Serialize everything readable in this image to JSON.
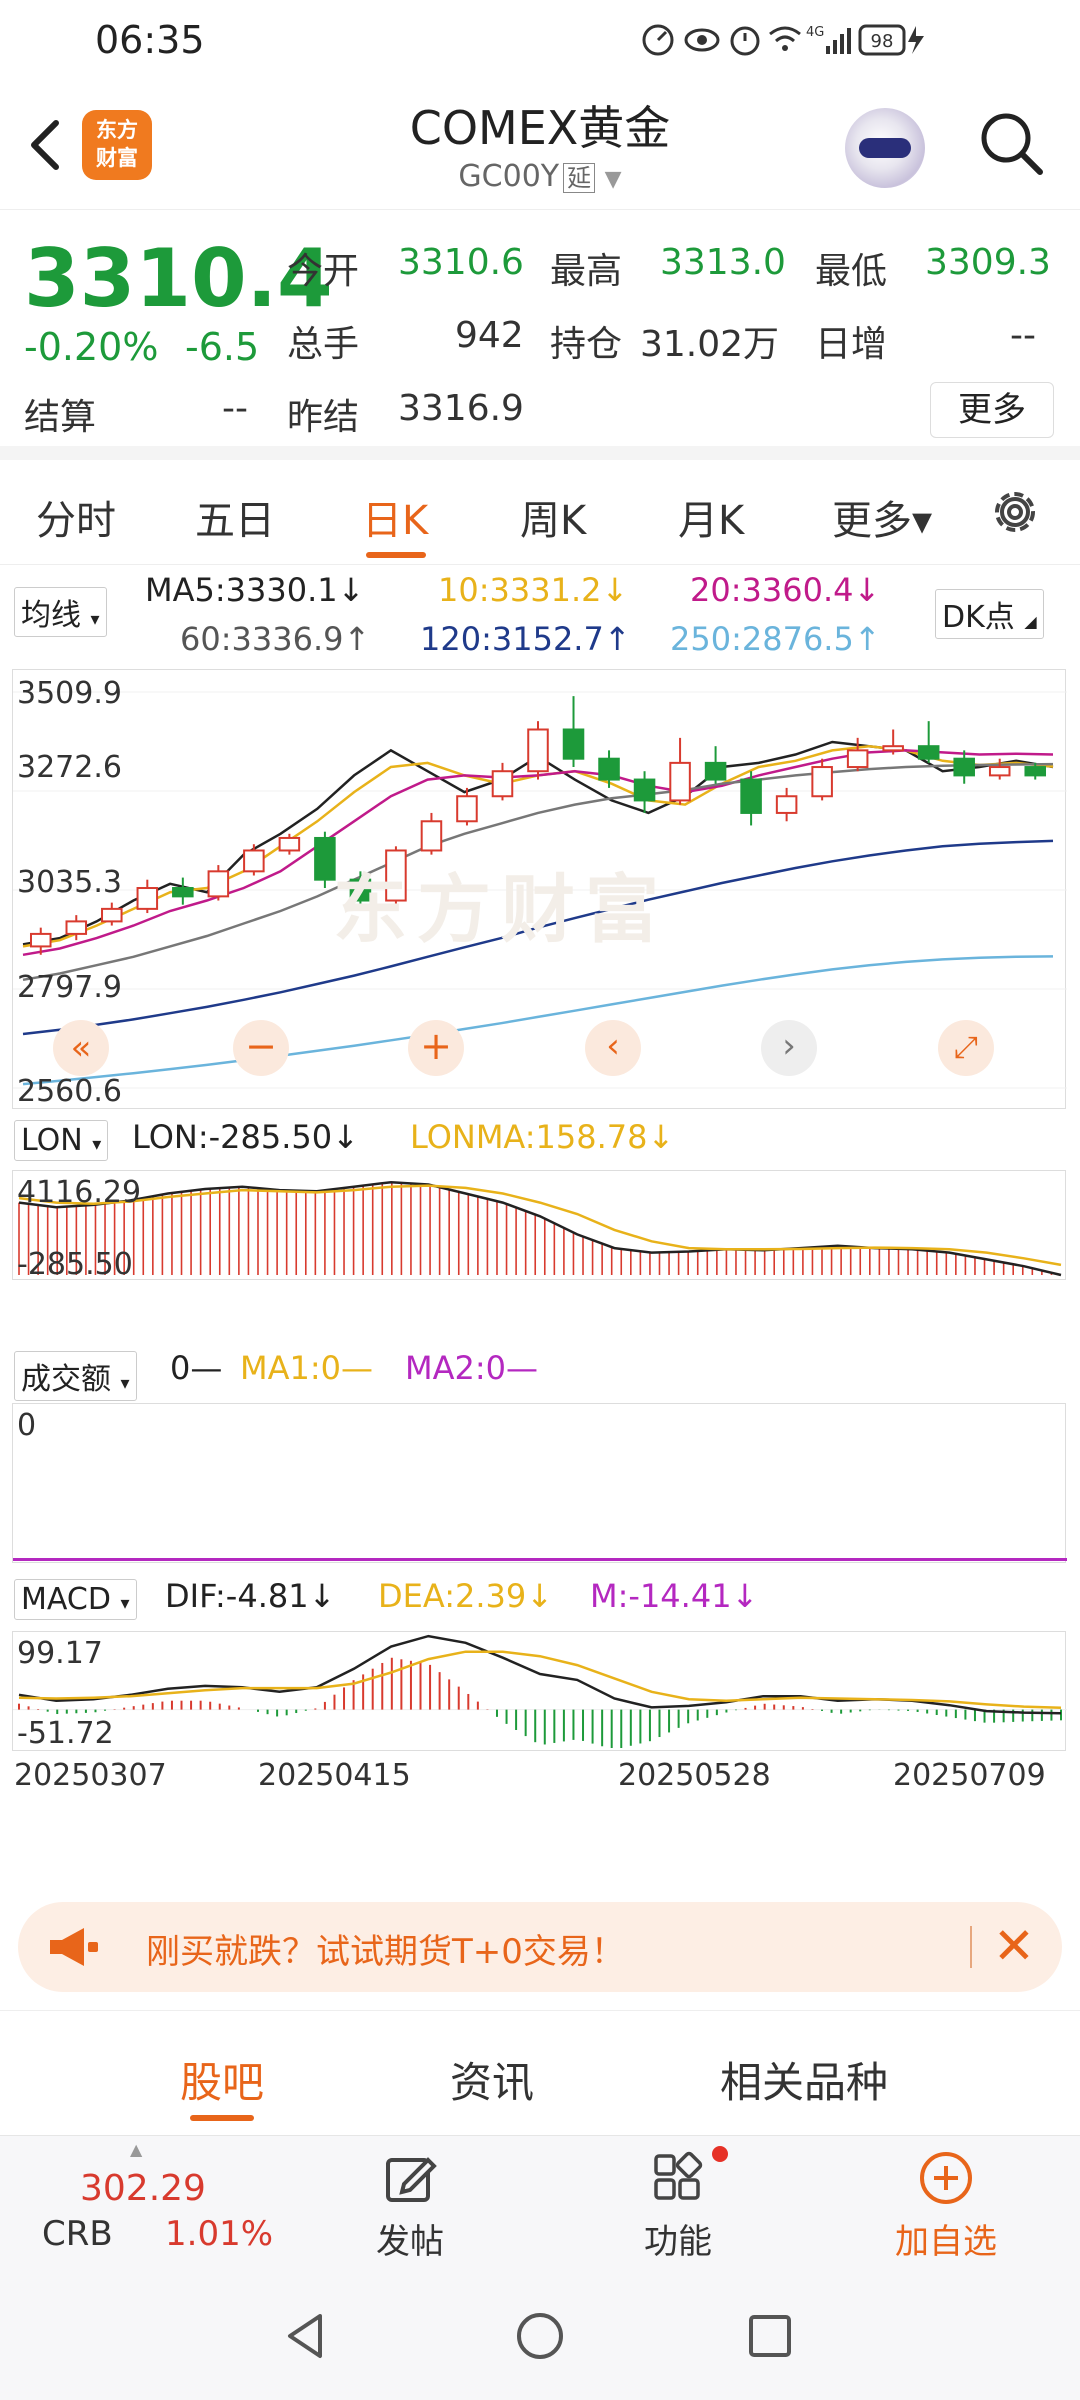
{
  "status_bar": {
    "time": "06:35",
    "network": "4G",
    "battery": "98"
  },
  "header": {
    "logo_line1": "东方",
    "logo_line2": "财富",
    "title": "COMEX黄金",
    "code": "GC00Y",
    "delay_tag": "延"
  },
  "quote": {
    "price": "3310.4",
    "change_pct": "-0.20%",
    "change_abs": "-6.5",
    "settle_label": "结算",
    "settle_value": "--",
    "open_label": "今开",
    "open_value": "3310.6",
    "high_label": "最高",
    "high_value": "3313.0",
    "low_label": "最低",
    "low_value": "3309.3",
    "volume_label": "总手",
    "volume_value": "942",
    "oi_label": "持仓",
    "oi_value": "31.02万",
    "daily_inc_label": "日增",
    "daily_inc_value": "--",
    "prev_settle_label": "昨结",
    "prev_settle_value": "3316.9",
    "more_label": "更多"
  },
  "period_tabs": [
    "分时",
    "五日",
    "日K",
    "周K",
    "月K",
    "更多▾"
  ],
  "active_period": "日K",
  "colors": {
    "accent": "#e8651a",
    "up": "#d83a2e",
    "down": "#1d9a3a",
    "ma5": "#222222",
    "ma10": "#e8b21a",
    "ma20": "#c01a8a",
    "ma60": "#777777",
    "ma120": "#1f3a8a",
    "ma250": "#6ab4dc"
  },
  "ma_legend": {
    "selector": "均线",
    "ma5": "MA5:3330.1↓",
    "ma10": "10:3331.2↓",
    "ma20": "20:3360.4↓",
    "ma60": "60:3336.9↑",
    "ma120": "120:3152.7↑",
    "ma250": "250:2876.5↑",
    "dk_button": "DK点"
  },
  "chart_data": [
    {
      "type": "candlestick",
      "title": "",
      "y_ticks": [
        "3509.9",
        "3272.6",
        "3035.3",
        "2797.9",
        "2560.6"
      ],
      "ylim": [
        2560.6,
        3509.9
      ],
      "x_ticks": [
        "20250307",
        "20250415",
        "20250528",
        "20250709"
      ],
      "series": [
        {
          "name": "MA5",
          "values": [
            2905,
            2920,
            2960,
            3010,
            3050,
            3030,
            3120,
            3170,
            3230,
            3310,
            3370,
            3320,
            3270,
            3300,
            3355,
            3300,
            3250,
            3220,
            3260,
            3330,
            3340,
            3360,
            3390,
            3380,
            3370,
            3320,
            3330,
            3345,
            3330
          ]
        },
        {
          "name": "MA10",
          "values": [
            2900,
            2915,
            2950,
            2990,
            3030,
            3040,
            3080,
            3140,
            3200,
            3270,
            3330,
            3340,
            3310,
            3290,
            3310,
            3320,
            3290,
            3250,
            3240,
            3290,
            3330,
            3345,
            3370,
            3380,
            3370,
            3345,
            3335,
            3340,
            3331
          ]
        },
        {
          "name": "MA20",
          "values": [
            2880,
            2895,
            2920,
            2950,
            2985,
            3010,
            3040,
            3080,
            3140,
            3200,
            3260,
            3300,
            3310,
            3305,
            3310,
            3320,
            3310,
            3285,
            3270,
            3285,
            3310,
            3330,
            3350,
            3365,
            3370,
            3365,
            3360,
            3362,
            3360
          ]
        },
        {
          "name": "MA60",
          "values": [
            2820,
            2835,
            2855,
            2875,
            2900,
            2925,
            2955,
            2985,
            3020,
            3060,
            3100,
            3140,
            3170,
            3195,
            3220,
            3240,
            3255,
            3265,
            3275,
            3290,
            3300,
            3310,
            3318,
            3325,
            3330,
            3333,
            3335,
            3336,
            3337
          ]
        },
        {
          "name": "MA120",
          "values": [
            2690,
            2700,
            2712,
            2725,
            2740,
            2755,
            2772,
            2790,
            2810,
            2830,
            2852,
            2875,
            2898,
            2920,
            2945,
            2968,
            2990,
            3012,
            3032,
            3052,
            3070,
            3088,
            3104,
            3118,
            3130,
            3140,
            3146,
            3150,
            3153
          ]
        },
        {
          "name": "MA250",
          "values": [
            2570,
            2578,
            2587,
            2596,
            2606,
            2616,
            2627,
            2638,
            2650,
            2662,
            2675,
            2688,
            2702,
            2716,
            2731,
            2746,
            2761,
            2776,
            2791,
            2806,
            2820,
            2833,
            2845,
            2855,
            2863,
            2869,
            2873,
            2875,
            2876
          ]
        }
      ],
      "candles": [
        [
          2900,
          2930,
          2880,
          2945
        ],
        [
          2930,
          2960,
          2915,
          2975
        ],
        [
          2960,
          2990,
          2950,
          3005
        ],
        [
          2990,
          3040,
          2980,
          3060
        ],
        [
          3040,
          3020,
          3000,
          3065
        ],
        [
          3020,
          3080,
          3010,
          3095
        ],
        [
          3080,
          3130,
          3070,
          3145
        ],
        [
          3130,
          3160,
          3120,
          3170
        ],
        [
          3160,
          3060,
          3040,
          3175
        ],
        [
          3060,
          3010,
          2990,
          3080
        ],
        [
          3010,
          3130,
          3000,
          3140
        ],
        [
          3130,
          3200,
          3120,
          3220
        ],
        [
          3200,
          3260,
          3190,
          3280
        ],
        [
          3260,
          3320,
          3250,
          3340
        ],
        [
          3320,
          3420,
          3300,
          3440
        ],
        [
          3420,
          3350,
          3330,
          3500
        ],
        [
          3350,
          3300,
          3280,
          3370
        ],
        [
          3300,
          3250,
          3220,
          3320
        ],
        [
          3250,
          3340,
          3240,
          3400
        ],
        [
          3340,
          3300,
          3290,
          3380
        ],
        [
          3300,
          3220,
          3190,
          3320
        ],
        [
          3220,
          3260,
          3200,
          3280
        ],
        [
          3260,
          3330,
          3250,
          3350
        ],
        [
          3330,
          3370,
          3320,
          3400
        ],
        [
          3370,
          3380,
          3360,
          3420
        ],
        [
          3380,
          3350,
          3340,
          3440
        ],
        [
          3350,
          3310,
          3290,
          3370
        ],
        [
          3310,
          3330,
          3300,
          3350
        ],
        [
          3330,
          3310,
          3300,
          3340
        ]
      ]
    },
    {
      "type": "line",
      "title": "",
      "y_ticks": [
        "4116.29",
        "-285.50"
      ],
      "ylim": [
        -285.5,
        4116.29
      ],
      "series": [
        {
          "name": "LON",
          "values": [
            2900,
            2700,
            2800,
            3000,
            3300,
            3500,
            3600,
            3450,
            3400,
            3600,
            3800,
            3700,
            3300,
            2900,
            2300,
            1500,
            900,
            700,
            750,
            850,
            800,
            900,
            1000,
            900,
            850,
            700,
            400,
            100,
            -285.5
          ]
        },
        {
          "name": "LONMA",
          "values": [
            3100,
            2900,
            2850,
            2950,
            3150,
            3300,
            3450,
            3400,
            3350,
            3450,
            3600,
            3650,
            3550,
            3300,
            2900,
            2400,
            1700,
            1200,
            900,
            850,
            850,
            860,
            900,
            920,
            900,
            850,
            700,
            450,
            158.78
          ]
        }
      ]
    },
    {
      "type": "line",
      "title": "",
      "y_ticks": [
        "0"
      ],
      "series": [
        {
          "name": "MA1",
          "values": [
            0
          ]
        },
        {
          "name": "MA2",
          "values": [
            0
          ]
        }
      ]
    },
    {
      "type": "line",
      "title": "",
      "y_ticks": [
        "99.17",
        "-51.72"
      ],
      "ylim": [
        -51.72,
        99.17
      ],
      "x_ticks": [
        "20250307",
        "20250415",
        "20250528",
        "20250709"
      ],
      "series": [
        {
          "name": "DIF",
          "values": [
            20,
            12,
            14,
            20,
            28,
            32,
            30,
            24,
            30,
            55,
            85,
            99,
            90,
            70,
            48,
            40,
            15,
            3,
            5,
            10,
            18,
            18,
            12,
            14,
            12,
            6,
            -2,
            -4,
            -4.81
          ]
        },
        {
          "name": "DEA",
          "values": [
            16,
            15,
            16,
            18,
            22,
            26,
            29,
            29,
            29,
            35,
            50,
            68,
            78,
            78,
            72,
            60,
            42,
            24,
            14,
            12,
            14,
            16,
            15,
            14,
            13,
            11,
            7,
            4,
            2.39
          ]
        },
        {
          "name": "M",
          "values": [
            8,
            -6,
            -4,
            4,
            12,
            12,
            2,
            -10,
            2,
            40,
            70,
            62,
            24,
            -16,
            -48,
            -40,
            -54,
            -42,
            -18,
            -4,
            8,
            4,
            -6,
            0,
            -2,
            -10,
            -18,
            -16,
            -14.41
          ]
        }
      ]
    }
  ],
  "lon_legend": {
    "selector": "LON",
    "lon": "LON:-285.50↓",
    "lonma": "LONMA:158.78↓"
  },
  "volume_legend": {
    "selector": "成交额",
    "value": "0—",
    "ma1": "MA1:0—",
    "ma2": "MA2:0—"
  },
  "macd_legend": {
    "selector": "MACD",
    "dif": "DIF:-4.81↓",
    "dea": "DEA:2.39↓",
    "m": "M:-14.41↓"
  },
  "promo": {
    "text": "刚买就跌？试试期货T+0交易！"
  },
  "content_tabs": [
    "股吧",
    "资讯",
    "相关品种"
  ],
  "bottom_bar": {
    "crb_value": "302.29",
    "crb_label": "CRB",
    "crb_pct": "1.01%",
    "post_label": "发帖",
    "function_label": "功能",
    "add_watch_label": "加自选"
  }
}
